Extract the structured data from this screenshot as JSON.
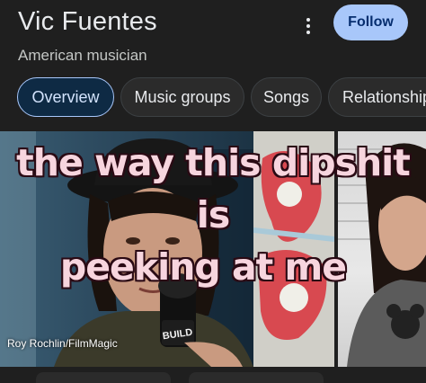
{
  "header": {
    "title": "Vic Fuentes",
    "subtitle": "American musician",
    "more_icon": "more-vertical-icon",
    "follow_label": "Follow"
  },
  "tabs": [
    {
      "label": "Overview",
      "active": true
    },
    {
      "label": "Music groups",
      "active": false
    },
    {
      "label": "Songs",
      "active": false
    },
    {
      "label": "Relationships",
      "active": false
    }
  ],
  "gallery": {
    "photo_credit": "Roy Rochlin/FilmMagic",
    "meme_line1": "the way this dipshit is",
    "meme_line2": "peeking at me",
    "microphone_text": "BUILD"
  },
  "colors": {
    "background": "#1f1f1f",
    "follow_button": "#a8c7fa",
    "active_tab_border": "#a8c7fa",
    "meme_text": "#f7d5de"
  }
}
